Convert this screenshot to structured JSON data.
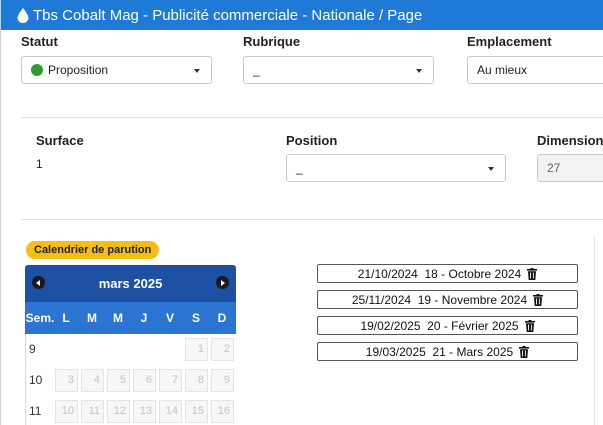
{
  "window": {
    "title": "Tbs Cobalt Mag - Publicité commerciale - Nationale / Page"
  },
  "colors": {
    "titlebar": "#1e7ad6",
    "status_green": "#2e9b2e",
    "badge_yellow": "#f6bd16",
    "calendar_header": "#1d4fa3",
    "calendar_dow": "#2b74d1"
  },
  "fields": {
    "statut": {
      "label": "Statut",
      "value": "Proposition",
      "icon": "green-dot-icon"
    },
    "rubrique": {
      "label": "Rubrique",
      "value": "_"
    },
    "emplacement": {
      "label": "Emplacement",
      "value": "Au mieux"
    },
    "surface": {
      "label": "Surface",
      "value": "1"
    },
    "position": {
      "label": "Position",
      "value": "_"
    },
    "dimension": {
      "label": "Dimension",
      "value": "27"
    }
  },
  "calendar": {
    "badge": "Calendrier de parution",
    "month": "mars 2025",
    "dow": [
      "Sem.",
      "L",
      "M",
      "M",
      "J",
      "V",
      "S",
      "D"
    ],
    "weeks": [
      {
        "num": "9",
        "days": [
          "",
          "",
          "",
          "",
          "",
          "1",
          "2"
        ]
      },
      {
        "num": "10",
        "days": [
          "3",
          "4",
          "5",
          "6",
          "7",
          "8",
          "9"
        ]
      },
      {
        "num": "11",
        "days": [
          "10",
          "11",
          "12",
          "13",
          "14",
          "15",
          "16"
        ]
      }
    ]
  },
  "parutions": [
    {
      "date": "21/10/2024",
      "label": "18 - Octobre 2024"
    },
    {
      "date": "25/11/2024",
      "label": "19 - Novembre 2024"
    },
    {
      "date": "19/02/2025",
      "label": "20 - Février 2025"
    },
    {
      "date": "19/03/2025",
      "label": "21 - Mars 2025"
    }
  ]
}
